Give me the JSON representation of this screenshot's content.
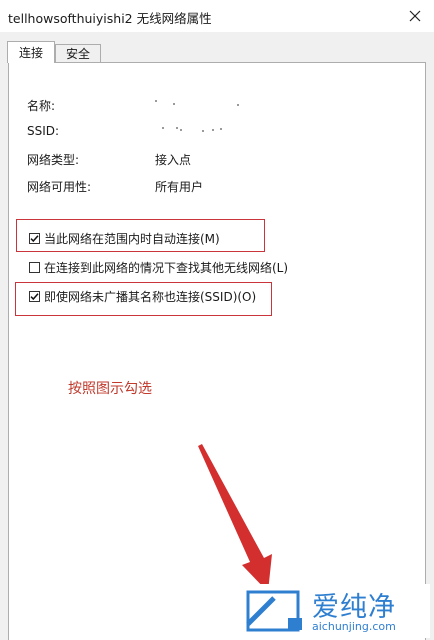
{
  "window": {
    "title": "tellhowsofthuiyishi2 无线网络属性",
    "close_icon": "close-icon"
  },
  "tabs": [
    {
      "label": "连接",
      "active": true
    },
    {
      "label": "安全",
      "active": false
    }
  ],
  "properties": [
    {
      "label": "名称:",
      "value": ""
    },
    {
      "label": "SSID:",
      "value": ""
    },
    {
      "label": "网络类型:",
      "value": "接入点"
    },
    {
      "label": "网络可用性:",
      "value": "所有用户"
    }
  ],
  "options": [
    {
      "label": "当此网络在范围内时自动连接(M)",
      "checked": true,
      "highlighted": true
    },
    {
      "label": "在连接到此网络的情况下查找其他无线网络(L)",
      "checked": false,
      "highlighted": false
    },
    {
      "label": "即使网络未广播其名称也连接(SSID)(O)",
      "checked": true,
      "highlighted": true
    }
  ],
  "annotation": {
    "text": "按照图示勾选",
    "color": "#c0392b"
  },
  "watermark": {
    "name": "爱纯净",
    "site": "aichunjing.com",
    "color": "#2f7fd1"
  },
  "colors": {
    "highlight_box": "#c9353a",
    "panel_background": "#ffffff",
    "dialog_background": "#f0f0f0"
  }
}
